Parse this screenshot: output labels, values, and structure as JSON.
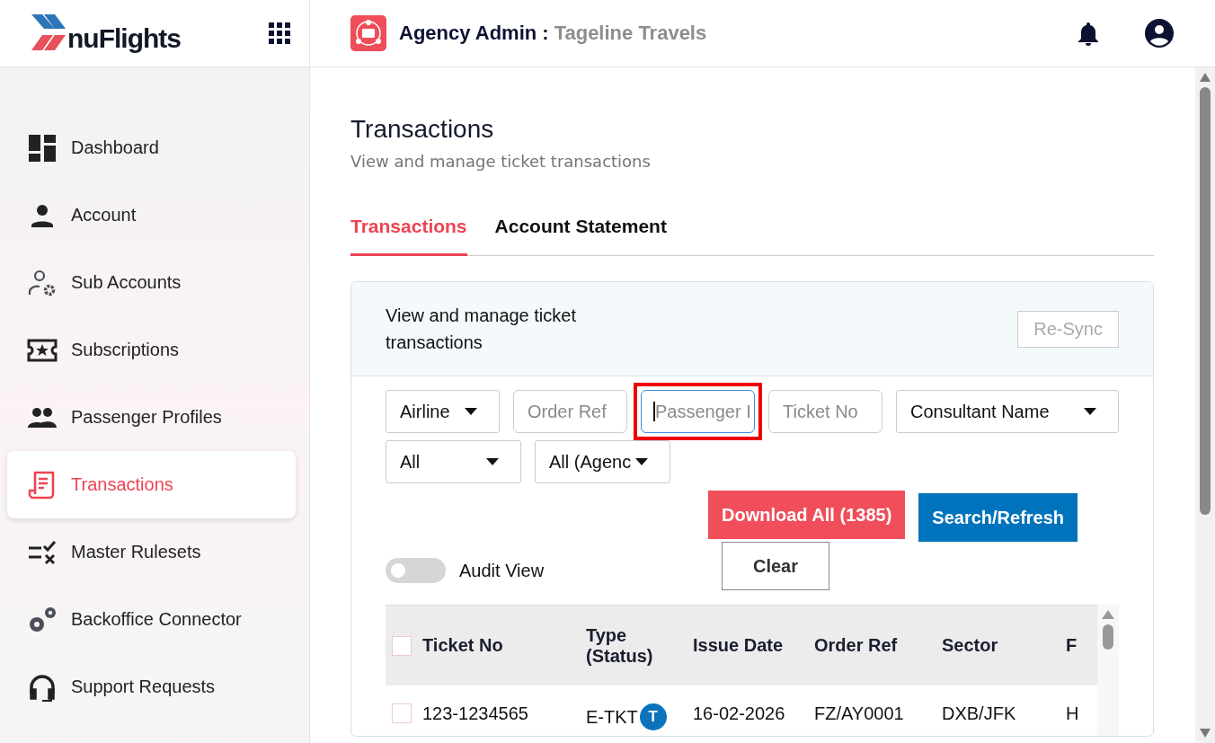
{
  "header": {
    "brand": "nuFlights",
    "title": "Agency Admin :",
    "agency": "Tageline Travels"
  },
  "sidebar": {
    "items": [
      {
        "label": "Dashboard",
        "selected": false
      },
      {
        "label": "Account",
        "selected": false
      },
      {
        "label": "Sub Accounts",
        "selected": false
      },
      {
        "label": "Subscriptions",
        "selected": false
      },
      {
        "label": "Passenger Profiles",
        "selected": false
      },
      {
        "label": "Transactions",
        "selected": true
      },
      {
        "label": "Master Rulesets",
        "selected": false
      },
      {
        "label": "Backoffice Connector",
        "selected": false
      },
      {
        "label": "Support Requests",
        "selected": false
      }
    ]
  },
  "page": {
    "title": "Transactions",
    "subtitle": "View and manage ticket transactions"
  },
  "tabs": [
    {
      "label": "Transactions",
      "selected": true
    },
    {
      "label": "Account Statement",
      "selected": false
    }
  ],
  "card": {
    "description": "View and manage ticket transactions",
    "resync_button": {
      "label": "Re-Sync",
      "disabled": true
    }
  },
  "filters": [
    {
      "kind": "dropdown",
      "value": "Airline",
      "wide": false
    },
    {
      "kind": "input",
      "placeholder": "Order Ref",
      "focused": false
    },
    {
      "kind": "input",
      "placeholder": "Passenger I",
      "focused": true,
      "highlighted": true
    },
    {
      "kind": "input",
      "placeholder": "Ticket No",
      "focused": false
    },
    {
      "kind": "dropdown",
      "value": "Consultant Name",
      "wide": true
    },
    {
      "kind": "dropdown",
      "value": "All",
      "wide": false
    },
    {
      "kind": "dropdown",
      "value": "All (Agenc",
      "wide": false
    }
  ],
  "buttons": [
    {
      "kind": "danger",
      "label": "Download All (1385)"
    },
    {
      "kind": "primary",
      "label": "Search/Refresh"
    },
    {
      "kind": "outline",
      "label": "Clear"
    }
  ],
  "audit_view": {
    "label": "Audit View",
    "on": false
  },
  "table": {
    "select_all_checked": false,
    "columns": [
      "Ticket No",
      "Type (Status)",
      "Issue Date",
      "Order Ref",
      "Sector",
      "F"
    ],
    "rows": [
      {
        "checked": false,
        "cells": [
          "123-1234565",
          "E-TKT",
          "16-02-2026",
          "FZ/AY0001",
          "DXB/JFK",
          "H"
        ],
        "status_badge": "T"
      }
    ]
  }
}
